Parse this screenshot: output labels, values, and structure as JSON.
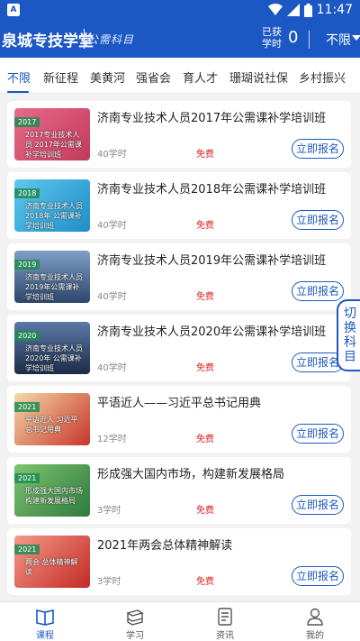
{
  "status_bar": {
    "time": "11:47",
    "app_icon": "app-notification-icon",
    "wifi_icon": "wifi-icon",
    "signal_icon": "signal-icon",
    "battery_icon": "battery-icon"
  },
  "header": {
    "brand": "泉城专技学堂",
    "subtitle": "公需科目",
    "hours_label": "已获学时",
    "hours_value": "0",
    "category": "不限"
  },
  "tabs": [
    "不限",
    "新征程",
    "美黄河",
    "强省会",
    "育人才",
    "珊瑚说社保",
    "乡村振兴"
  ],
  "courses": [
    {
      "title": "济南专业技术人员2017年公需课补学培训班",
      "hours": "40学时",
      "price": "免费",
      "button": "立即报名",
      "year": "2017",
      "caption": "2017专业技术人员 2017年公需课补学培训班",
      "bg": "#d94f6e"
    },
    {
      "title": "济南专业技术人员2018年公需课补学培训班",
      "hours": "40学时",
      "price": "免费",
      "button": "立即报名",
      "year": "2018",
      "caption": "济南专业技术人员 2018年 公需课补学培训班",
      "bg": "#2aa6d9"
    },
    {
      "title": "济南专业技术人员2019年公需课补学培训班",
      "hours": "40学时",
      "price": "免费",
      "button": "立即报名",
      "year": "2019",
      "caption": "济南专业技术人员 2019年公需课补学培训班",
      "bg": "#3f5f8a"
    },
    {
      "title": "济南专业技术人员2020年公需课补学培训班",
      "hours": "40学时",
      "price": "免费",
      "button": "立即报名",
      "year": "2020",
      "caption": "济南专业技术人员2020年 公需课补学培训班",
      "bg": "#2b3f63"
    },
    {
      "title": "平语近人——习近平总书记用典",
      "hours": "12学时",
      "price": "免费",
      "button": "立即报名",
      "year": "2021",
      "caption": "平语近人 习近平总书记用典",
      "bg": "#c8352a"
    },
    {
      "title": "形成强大国内市场，构建新发展格局",
      "hours": "3学时",
      "price": "免费",
      "button": "立即报名",
      "year": "2021",
      "caption": "形成强大国内市场 构建新发展格局",
      "bg": "#3a8f4a"
    },
    {
      "title": "2021年两会总体精神解读",
      "hours": "3学时",
      "price": "免费",
      "button": "立即报名",
      "year": "2021",
      "caption": "两会 总体精神解读",
      "bg": "#cf2f2a"
    }
  ],
  "switch_label": "切换科目",
  "bottom_nav": [
    {
      "label": "课程",
      "icon": "book-open-icon"
    },
    {
      "label": "学习",
      "icon": "books-stack-icon"
    },
    {
      "label": "资讯",
      "icon": "news-document-icon"
    },
    {
      "label": "我的",
      "icon": "user-icon"
    }
  ],
  "colors": {
    "primary": "#1c58c4",
    "price": "#e02020",
    "background": "#f2f2f2"
  }
}
